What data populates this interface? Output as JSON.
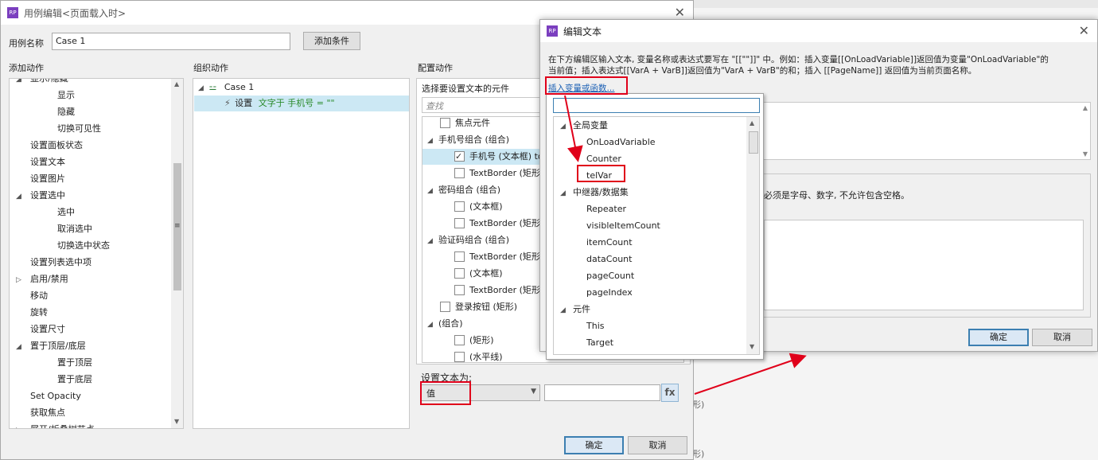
{
  "case_editor": {
    "title": "用例编辑<页面载入时>",
    "case_name_label": "用例名称",
    "case_name_value": "Case 1",
    "add_condition": "添加条件",
    "add_action_header": "添加动作",
    "organize_header": "组织动作",
    "config_header": "配置动作",
    "actions": [
      {
        "label": "显示/隐藏",
        "level": 1,
        "expand": "▲"
      },
      {
        "label": "显示",
        "level": 2
      },
      {
        "label": "隐藏",
        "level": 2
      },
      {
        "label": "切换可见性",
        "level": 2
      },
      {
        "label": "设置面板状态",
        "level": 1
      },
      {
        "label": "设置文本",
        "level": 1
      },
      {
        "label": "设置图片",
        "level": 1
      },
      {
        "label": "设置选中",
        "level": 1,
        "expand": "◢"
      },
      {
        "label": "选中",
        "level": 2
      },
      {
        "label": "取消选中",
        "level": 2
      },
      {
        "label": "切换选中状态",
        "level": 2
      },
      {
        "label": "设置列表选中项",
        "level": 1
      },
      {
        "label": "启用/禁用",
        "level": 1,
        "expand": "▷"
      },
      {
        "label": "移动",
        "level": 1
      },
      {
        "label": "旋转",
        "level": 1
      },
      {
        "label": "设置尺寸",
        "level": 1
      },
      {
        "label": "置于顶层/底层",
        "level": 1,
        "expand": "◢"
      },
      {
        "label": "置于顶层",
        "level": 2
      },
      {
        "label": "置于底层",
        "level": 2
      },
      {
        "label": "Set Opacity",
        "level": 1
      },
      {
        "label": "获取焦点",
        "level": 1
      },
      {
        "label": "展开/折叠树节点",
        "level": 1,
        "expand": "▷"
      }
    ],
    "case_node": "Case 1",
    "action_set": "设置",
    "action_detail": "文字于 手机号 = \"\"",
    "select_widget_label": "选择要设置文本的元件",
    "search_placeholder": "查找",
    "widgets": [
      {
        "label": "焦点元件",
        "indent": 1,
        "type": "cb"
      },
      {
        "label": "手机号组合 (组合)",
        "indent": 0,
        "type": "group"
      },
      {
        "label": "手机号 (文本框) to \"\"",
        "indent": 2,
        "type": "cb",
        "checked": true,
        "selected": true
      },
      {
        "label": "TextBorder (矩形)",
        "indent": 2,
        "type": "cb"
      },
      {
        "label": "密码组合 (组合)",
        "indent": 0,
        "type": "group"
      },
      {
        "label": "(文本框)",
        "indent": 2,
        "type": "cb"
      },
      {
        "label": "TextBorder (矩形)",
        "indent": 2,
        "type": "cb"
      },
      {
        "label": "验证码组合 (组合)",
        "indent": 0,
        "type": "group"
      },
      {
        "label": "TextBorder (矩形)",
        "indent": 2,
        "type": "cb"
      },
      {
        "label": "(文本框)",
        "indent": 2,
        "type": "cb"
      },
      {
        "label": "TextBorder (矩形)",
        "indent": 2,
        "type": "cb"
      },
      {
        "label": "登录按钮 (矩形)",
        "indent": 1,
        "type": "cb"
      },
      {
        "label": "(组合)",
        "indent": 0,
        "type": "group"
      },
      {
        "label": "(矩形)",
        "indent": 2,
        "type": "cb"
      },
      {
        "label": "(水平线)",
        "indent": 2,
        "type": "cb"
      }
    ],
    "set_text_to_label": "设置文本为:",
    "value_option": "值",
    "fx_label": "fx",
    "ok": "确定",
    "cancel": "取消"
  },
  "edit_text": {
    "title": "编辑文本",
    "instruction_line1": "在下方编辑区输入文本, 变量名称或表达式要写在 \"[[\"\"]]\" 中。例如：插入变量[[OnLoadVariable]]返回值为变量\"OnLoadVariable\"的",
    "instruction_line2": "当前值；插入表达式[[VarA + VarB]]返回值为\"VarA + VarB\"的和；插入 [[PageName]] 返回值为当前页面名称。",
    "insert_link": "插入变量或函数...",
    "local_var_hint": "必须是字母、数字, 不允许包含空格。",
    "ok": "确定",
    "cancel": "取消"
  },
  "variable_dropdown": {
    "items": [
      {
        "label": "全局变量",
        "type": "header"
      },
      {
        "label": "OnLoadVariable",
        "type": "item"
      },
      {
        "label": "Counter",
        "type": "item"
      },
      {
        "label": "telVar",
        "type": "item"
      },
      {
        "label": "中继器/数据集",
        "type": "header"
      },
      {
        "label": "Repeater",
        "type": "item"
      },
      {
        "label": "visibleItemCount",
        "type": "item"
      },
      {
        "label": "itemCount",
        "type": "item"
      },
      {
        "label": "dataCount",
        "type": "item"
      },
      {
        "label": "pageCount",
        "type": "item"
      },
      {
        "label": "pageIndex",
        "type": "item"
      },
      {
        "label": "元件",
        "type": "header"
      },
      {
        "label": "This",
        "type": "item"
      },
      {
        "label": "Target",
        "type": "item"
      }
    ]
  },
  "background": {
    "fragments": [
      "形)",
      "形)"
    ]
  },
  "colors": {
    "annotation_red": "#e0001a",
    "selection_blue": "#cce8f4",
    "link_blue": "#1a5fb4",
    "purple_logo": "#7b3fbf"
  },
  "icons": [
    "axure-logo-icon",
    "close-icon",
    "case-icon",
    "lightning-icon",
    "fx-icon",
    "dropdown-arrow-icon"
  ]
}
